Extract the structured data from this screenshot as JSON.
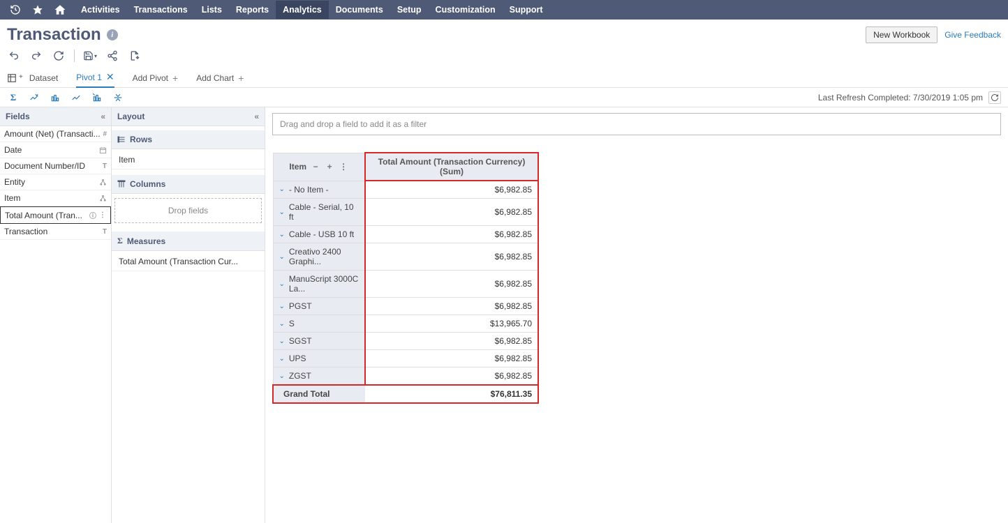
{
  "nav": {
    "items": [
      "Activities",
      "Transactions",
      "Lists",
      "Reports",
      "Analytics",
      "Documents",
      "Setup",
      "Customization",
      "Support"
    ],
    "active_index": 4
  },
  "title": "Transaction",
  "buttons": {
    "new_workbook": "New Workbook",
    "give_feedback": "Give Feedback"
  },
  "tabs": {
    "dataset": "Dataset",
    "pivot1": "Pivot 1",
    "add_pivot": "Add Pivot",
    "add_chart": "Add Chart"
  },
  "refresh_text": "Last Refresh Completed: 7/30/2019 1:05 pm",
  "fields_panel": {
    "title": "Fields",
    "items": [
      {
        "label": "Amount (Net) (Transacti...",
        "type": "#"
      },
      {
        "label": "Date",
        "type": "cal"
      },
      {
        "label": "Document Number/ID",
        "type": "T"
      },
      {
        "label": "Entity",
        "type": "tree"
      },
      {
        "label": "Item",
        "type": "tree"
      },
      {
        "label": "Total Amount (Tran...",
        "type": "info",
        "selected": true
      },
      {
        "label": "Transaction",
        "type": "T"
      }
    ]
  },
  "layout_panel": {
    "title": "Layout",
    "rows_label": "Rows",
    "rows_chip": "Item",
    "columns_label": "Columns",
    "drop_text": "Drop fields",
    "measures_label": "Measures",
    "measures_chip": "Total Amount (Transaction Cur..."
  },
  "filter_placeholder": "Drag and drop a field to add it as a filter",
  "pivot": {
    "item_header": "Item",
    "measure_header": "Total Amount (Transaction Currency) (Sum)",
    "rows": [
      {
        "label": "- No Item -",
        "value": "$6,982.85"
      },
      {
        "label": "Cable - Serial, 10 ft",
        "value": "$6,982.85"
      },
      {
        "label": "Cable - USB 10 ft",
        "value": "$6,982.85"
      },
      {
        "label": "Creativo 2400 Graphi...",
        "value": "$6,982.85"
      },
      {
        "label": "ManuScript 3000C La...",
        "value": "$6,982.85"
      },
      {
        "label": "PGST",
        "value": "$6,982.85"
      },
      {
        "label": "S",
        "value": "$13,965.70"
      },
      {
        "label": "SGST",
        "value": "$6,982.85"
      },
      {
        "label": "UPS",
        "value": "$6,982.85"
      },
      {
        "label": "ZGST",
        "value": "$6,982.85"
      }
    ],
    "grand_label": "Grand Total",
    "grand_value": "$76,811.35"
  }
}
